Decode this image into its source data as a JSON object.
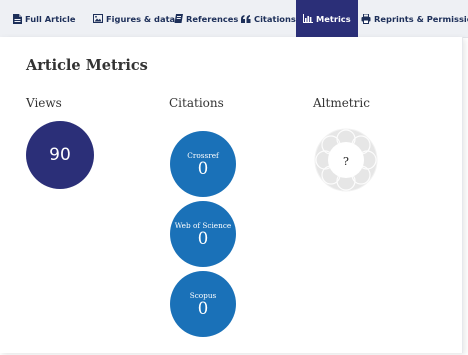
{
  "tabs": [
    {
      "label": "Full Article",
      "icon": "document-icon",
      "active": false
    },
    {
      "label": "Figures & data",
      "icon": "image-icon",
      "active": false
    },
    {
      "label": "References",
      "icon": "book-icon",
      "active": false
    },
    {
      "label": "Citations",
      "icon": "quote-icon",
      "active": false
    },
    {
      "label": "Metrics",
      "icon": "bar-chart-icon",
      "active": true
    },
    {
      "label": "Reprints & Permissions",
      "icon": "printer-icon",
      "active": false
    }
  ],
  "metrics": {
    "title": "Article Metrics",
    "views": {
      "heading": "Views",
      "value": "90"
    },
    "citations": {
      "heading": "Citations",
      "items": [
        {
          "label": "Crossref",
          "value": "0"
        },
        {
          "label": "Web of Science",
          "value": "0"
        },
        {
          "label": "Scopus",
          "value": "0"
        }
      ]
    },
    "altmetric": {
      "heading": "Altmetric",
      "value": "?"
    }
  },
  "colors": {
    "tab_bar_bg": "#eef0f4",
    "tab_text": "#1d2f59",
    "active_tab_bg": "#2b2f78",
    "views_circle": "#2b2f78",
    "citation_circle": "#1a71b8",
    "altmetric_donut": "#e6e6e6"
  }
}
